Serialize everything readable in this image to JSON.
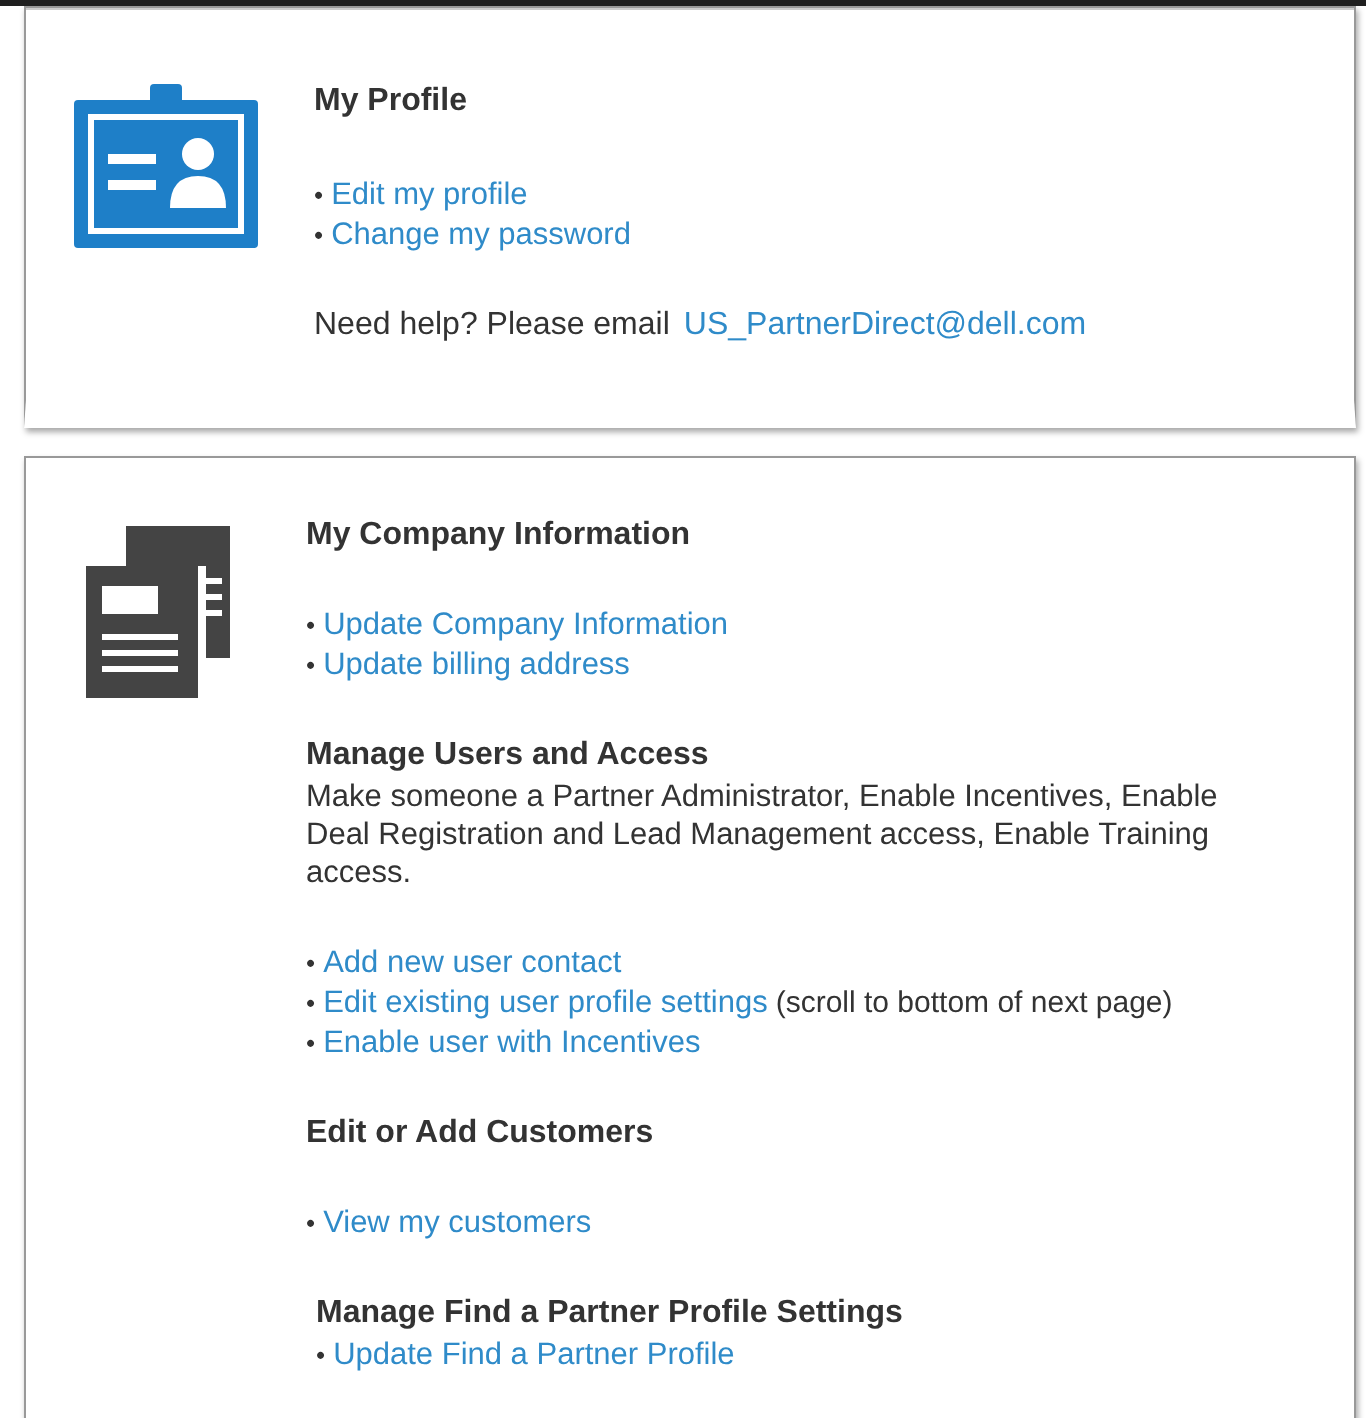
{
  "profile": {
    "heading": "My Profile",
    "links": [
      {
        "bullet": "•",
        "text": "Edit my profile"
      },
      {
        "bullet": "•",
        "text": "Change my password"
      }
    ],
    "help": {
      "text": "Need help? Please email",
      "email": "US_PartnerDirect@dell.com"
    }
  },
  "company": {
    "blocks": [
      {
        "kind": "heading",
        "text": "My Company Information"
      },
      {
        "kind": "links",
        "items": [
          {
            "bullet": "•",
            "text": "Update Company Information"
          },
          {
            "bullet": "•",
            "text": "Update billing address"
          }
        ]
      },
      {
        "kind": "group",
        "heading": "Manage Users and Access",
        "text": "Make someone a Partner Administrator, Enable Incentives, Enable Deal Registration and Lead Management access, Enable Training access."
      },
      {
        "kind": "links",
        "items": [
          {
            "bullet": "•",
            "text": "Add new user contact"
          },
          {
            "bullet": "•",
            "text": "Edit existing user profile settings",
            "note": "(scroll to bottom of next page)"
          },
          {
            "bullet": "•",
            "text": "Enable user with Incentives"
          }
        ]
      },
      {
        "kind": "heading",
        "text": "Edit or Add Customers"
      },
      {
        "kind": "links",
        "items": [
          {
            "bullet": "•",
            "text": "View my customers"
          }
        ]
      },
      {
        "kind": "group",
        "heading": "Manage Find a Partner Profile Settings",
        "items": [
          {
            "bullet": "•",
            "text": "Update Find a Partner Profile"
          }
        ]
      }
    ]
  }
}
